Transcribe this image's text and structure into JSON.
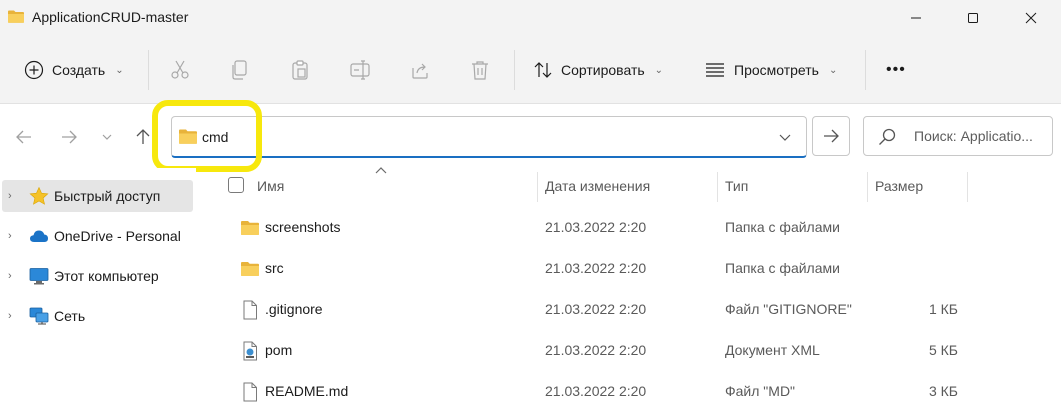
{
  "window": {
    "title": "ApplicationCRUD-master",
    "minimize_icon": "minimize-icon",
    "maximize_icon": "maximize-icon",
    "close_icon": "close-icon"
  },
  "toolbar": {
    "create_label": "Создать",
    "sort_label": "Сортировать",
    "view_label": "Просмотреть",
    "more_label": "•••",
    "tools": [
      "cut-icon",
      "copy-icon",
      "paste-icon",
      "rename-icon",
      "share-icon",
      "delete-icon"
    ]
  },
  "address": {
    "path": "cmd",
    "search_placeholder": "Поиск: Applicatio..."
  },
  "highlight_color": "#f7e80d",
  "sidebar": {
    "items": [
      {
        "label": "Быстрый доступ",
        "icon": "star-icon",
        "selected": true
      },
      {
        "label": "OneDrive - Personal",
        "icon": "cloud-icon",
        "selected": false
      },
      {
        "label": "Этот компьютер",
        "icon": "computer-icon",
        "selected": false
      },
      {
        "label": "Сеть",
        "icon": "network-icon",
        "selected": false
      }
    ]
  },
  "columns": {
    "name": "Имя",
    "date": "Дата изменения",
    "type": "Тип",
    "size": "Размер"
  },
  "files": [
    {
      "name": "screenshots",
      "date": "21.03.2022 2:20",
      "type": "Папка с файлами",
      "size": "",
      "icon": "folder-icon"
    },
    {
      "name": "src",
      "date": "21.03.2022 2:20",
      "type": "Папка с файлами",
      "size": "",
      "icon": "folder-icon"
    },
    {
      "name": ".gitignore",
      "date": "21.03.2022 2:20",
      "type": "Файл \"GITIGNORE\"",
      "size": "1 КБ",
      "icon": "file-icon"
    },
    {
      "name": "pom",
      "date": "21.03.2022 2:20",
      "type": "Документ XML",
      "size": "5 КБ",
      "icon": "xml-file-icon"
    },
    {
      "name": "README.md",
      "date": "21.03.2022 2:20",
      "type": "Файл \"MD\"",
      "size": "3 КБ",
      "icon": "file-icon"
    }
  ]
}
